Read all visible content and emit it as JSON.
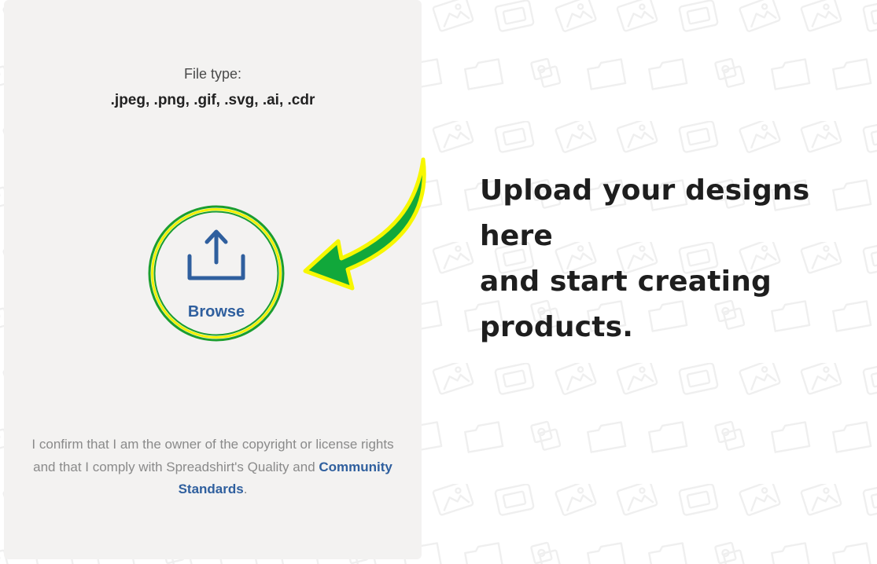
{
  "upload_panel": {
    "file_type_label": "File type:",
    "file_types": ".jpeg, .png, .gif, .svg, .ai, .cdr",
    "browse_label": "Browse",
    "confirm_text_before": "I confirm that I am the owner of the copyright or license rights and that I comply with Spreadshirt's Quality and ",
    "confirm_link": "Community Standards",
    "confirm_text_after": "."
  },
  "headline": {
    "line1": "Upload your designs here",
    "line2": "and start creating",
    "line3": "products."
  },
  "colors": {
    "panel_background": "#f3f2f1",
    "link_blue": "#2f5f9e",
    "ring_green": "#1a9e2f",
    "ring_yellow": "#f2f200",
    "arrow_green": "#11a83b",
    "arrow_yellow": "#f7f700"
  },
  "icons": {
    "upload": "upload-icon",
    "arrow": "curved-arrow-icon",
    "background": "image-placeholder-pattern"
  }
}
